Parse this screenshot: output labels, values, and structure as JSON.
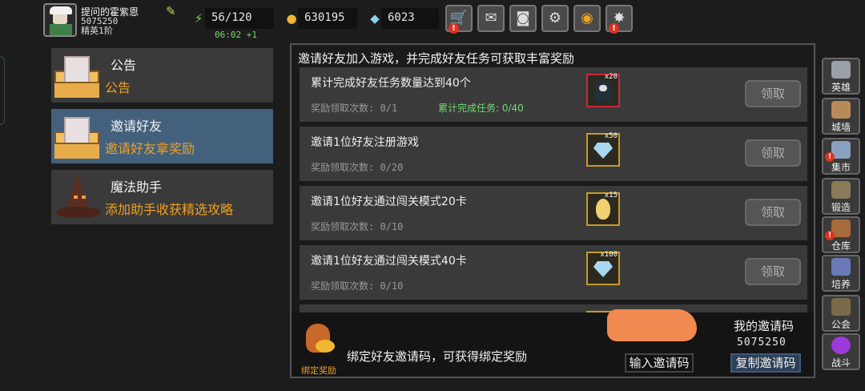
{
  "player": {
    "name": "提问的霍紫恩",
    "id": "5075250",
    "rank": "精英1阶"
  },
  "resources": {
    "energy": "56/120",
    "energy_timer": "06:02 +1",
    "gold": "630195",
    "gems": "6023"
  },
  "top_buttons": [
    {
      "name": "shop",
      "icon": "cart-icon",
      "alert": "!"
    },
    {
      "name": "mail",
      "icon": "mail-icon"
    },
    {
      "name": "gamepad",
      "icon": "gamepad-icon"
    },
    {
      "name": "settings",
      "icon": "gear-icon"
    },
    {
      "name": "color",
      "icon": "color-wheel-icon"
    },
    {
      "name": "event",
      "icon": "firework-icon",
      "alert": "!"
    }
  ],
  "menu": [
    {
      "title": "公告",
      "sub": "公告"
    },
    {
      "title": "邀请好友",
      "sub": "邀请好友拿奖励"
    },
    {
      "title": "魔法助手",
      "sub": "添加助手收获精选攻略"
    }
  ],
  "panel": {
    "title": "邀请好友加入游戏，并完成好友任务可获取丰富奖励",
    "claim_label": "领取",
    "tasks": [
      {
        "desc": "累计完成好友任务数量达到40个",
        "count": "奖励领取次数: 0/1",
        "extra": "累计完成任务: 0/40",
        "reward_qty": "x20"
      },
      {
        "desc": "邀请1位好友注册游戏",
        "count": "奖励领取次数: 0/20",
        "reward_qty": "x50"
      },
      {
        "desc": "邀请1位好友通过闯关模式20卡",
        "count": "奖励领取次数: 0/10",
        "reward_qty": "x15"
      },
      {
        "desc": "邀请1位好友通过闯关模式40卡",
        "count": "奖励领取次数: 0/10",
        "reward_qty": "x100"
      }
    ]
  },
  "bottom": {
    "bag_label": "绑定奖励",
    "bind_text": "绑定好友邀请码，可获得绑定奖励",
    "my_code_label": "我的邀请码",
    "my_code": "5075250",
    "input_label": "输入邀请码",
    "copy_label": "复制邀请码"
  },
  "sidebar": [
    {
      "label": "英雄",
      "icon": "helmet-icon",
      "color": "#9aa0a8"
    },
    {
      "label": "城墙",
      "icon": "wall-icon",
      "color": "#b88a5a"
    },
    {
      "label": "集市",
      "icon": "market-icon",
      "color": "#8aa0c0",
      "alert": "!"
    },
    {
      "label": "锻造",
      "icon": "anvil-icon",
      "color": "#8a7a5a"
    },
    {
      "label": "仓库",
      "icon": "warehouse-icon",
      "color": "#a86a3a",
      "alert": "!"
    },
    {
      "label": "培养",
      "icon": "chalice-icon",
      "color": "#6a7ab8"
    },
    {
      "label": "公会",
      "icon": "guild-icon",
      "color": "#7a6a4a"
    },
    {
      "label": "战斗",
      "icon": "portal-icon",
      "color": "#9a3ad8"
    }
  ]
}
